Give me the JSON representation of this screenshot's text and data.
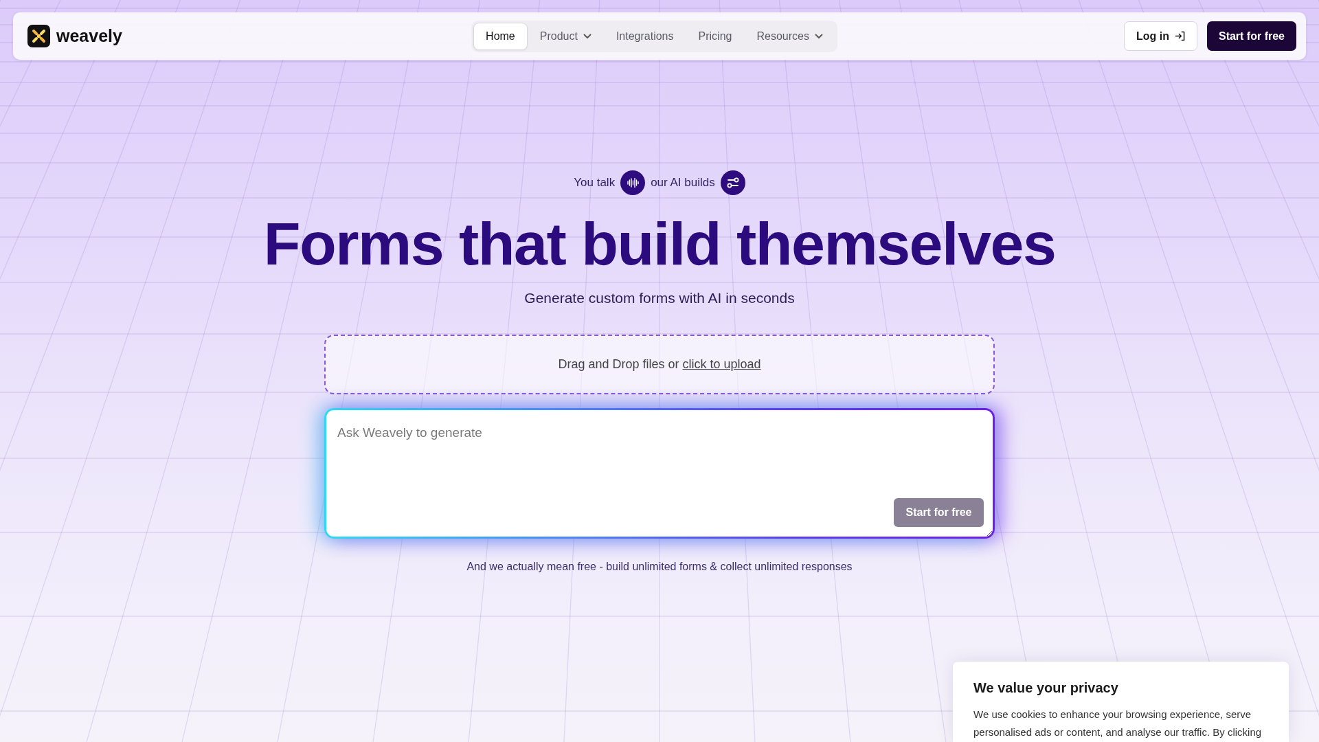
{
  "header": {
    "logo_text": "weavely",
    "nav": [
      {
        "label": "Home",
        "selected": true,
        "has_menu": false
      },
      {
        "label": "Product",
        "selected": false,
        "has_menu": true
      },
      {
        "label": "Integrations",
        "selected": false,
        "has_menu": false
      },
      {
        "label": "Pricing",
        "selected": false,
        "has_menu": false
      },
      {
        "label": "Resources",
        "selected": false,
        "has_menu": true
      }
    ],
    "login_button": "Log in",
    "signup_button": "Start for free"
  },
  "hero": {
    "tagline": [
      "You talk",
      "our AI builds"
    ],
    "title": "Forms that build themselves",
    "subtitle": "Generate custom forms with AI in seconds"
  },
  "upload": {
    "text": "Drag and Drop files or",
    "link": "click to upload"
  },
  "prompt": {
    "placeholder": "Ask Weavely to generate",
    "button": {
      "label": "Start for free",
      "disabled": true
    }
  },
  "note": "And we actually mean free - build unlimited forms & collect unlimited responses",
  "cookie_banner": {
    "title": "We value your privacy",
    "text": "We use cookies to enhance your browsing experience, serve personalised ads or content, and analyse our traffic. By clicking"
  }
}
